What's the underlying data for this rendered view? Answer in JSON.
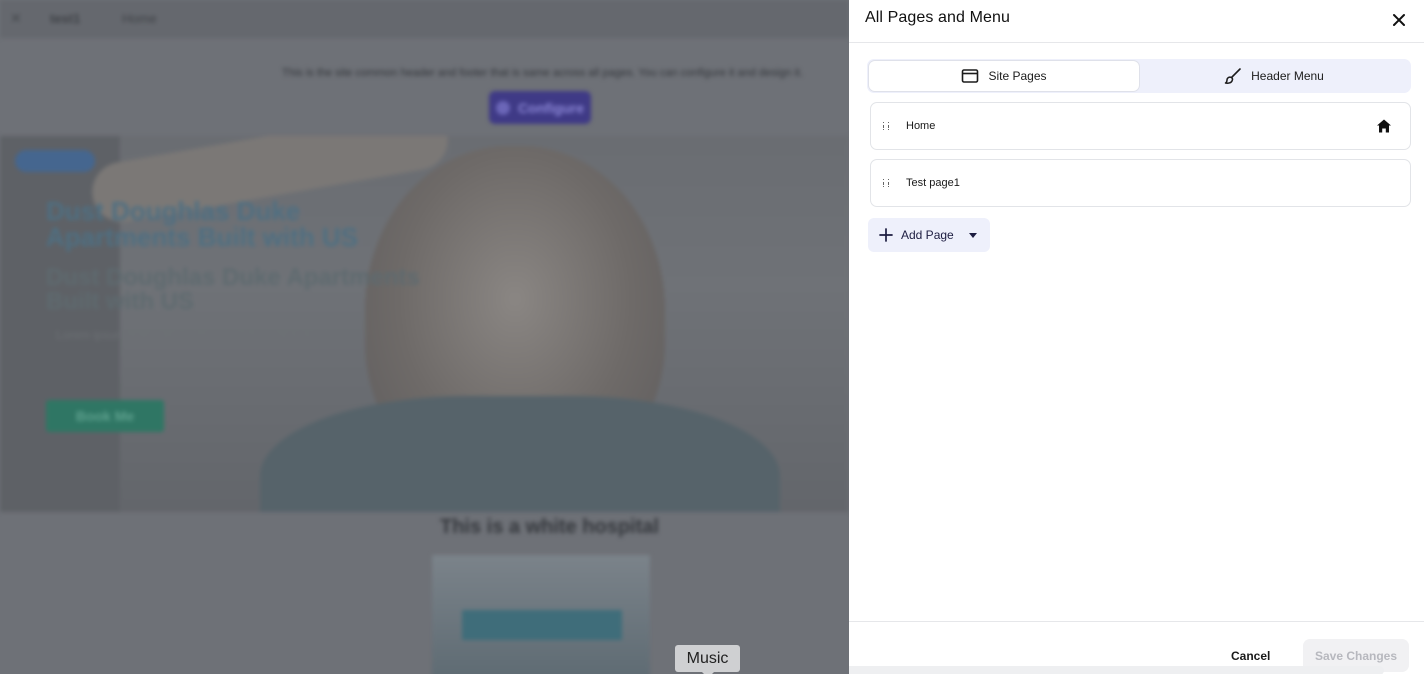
{
  "background": {
    "breadcrumb_site": "test1",
    "breadcrumb_page": "Home",
    "notice": "This is the site common header and footer that is same across all pages. You can configure it and design it.",
    "configure_label": "Configure",
    "hero_title": "Dust Doughlas Duke Apartments Built with US",
    "hero_title_2": "Dust Doughlas Duke Apartments Built with US",
    "hero_sub": "Lorem ipsum dolor sit amet consectetur adipiscing",
    "book_label": "Book Me",
    "below_title": "This is a white hospital"
  },
  "tooltip": {
    "text": "Music"
  },
  "drawer": {
    "title": "All Pages and Menu",
    "tabs": [
      {
        "label": "Site Pages",
        "icon": "browser-window-icon",
        "active": true
      },
      {
        "label": "Header Menu",
        "icon": "paintbrush-icon",
        "active": false
      }
    ],
    "pages": [
      {
        "label": "Home",
        "is_home": true
      },
      {
        "label": "Test page1",
        "is_home": false
      }
    ],
    "add_page_label": "Add Page",
    "footer": {
      "cancel_label": "Cancel",
      "save_label": "Save Changes"
    }
  },
  "colors": {
    "accent_bg": "#eef0fb",
    "overlay": "#6f7278",
    "disabled_text": "#b7b8be"
  }
}
